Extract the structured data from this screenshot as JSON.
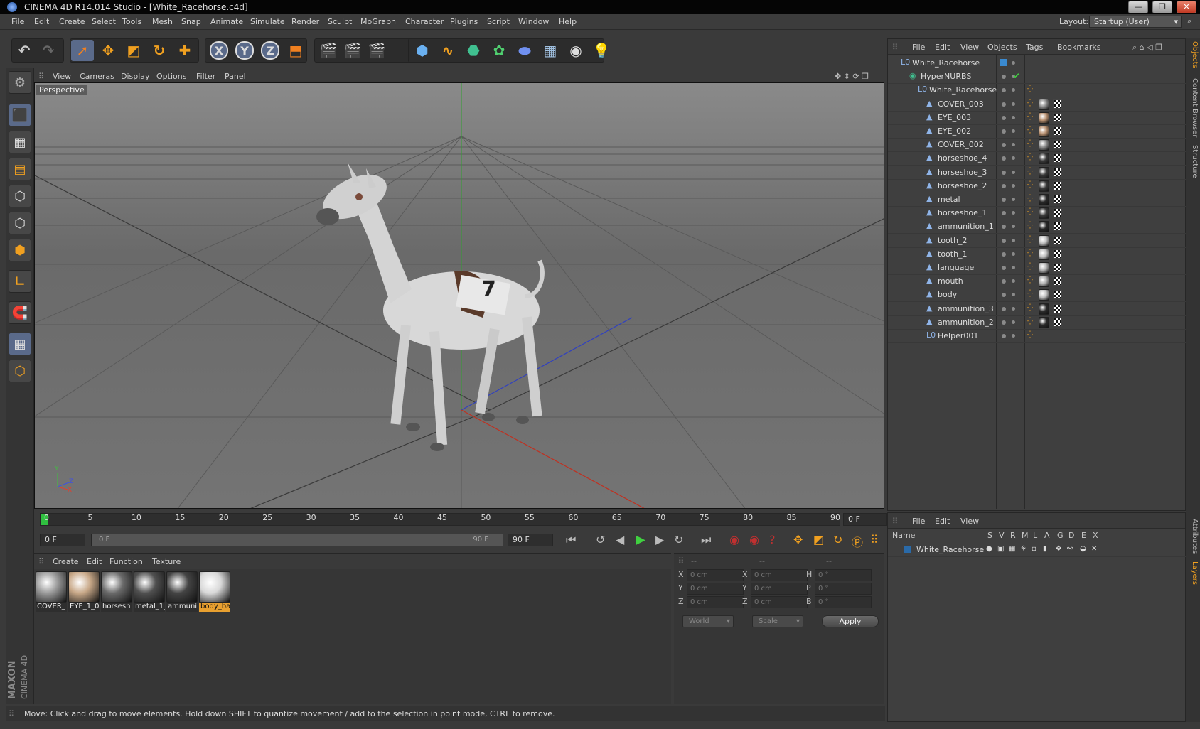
{
  "window": {
    "title": "CINEMA 4D R14.014 Studio - [White_Racehorse.c4d]",
    "buttons": [
      "—",
      "❐",
      "✕"
    ]
  },
  "menu": {
    "items": [
      "File",
      "Edit",
      "Create",
      "Select",
      "Tools",
      "Mesh",
      "Snap",
      "Animate",
      "Simulate",
      "Render",
      "Sculpt",
      "MoGraph",
      "Character",
      "Plugins",
      "Script",
      "Window",
      "Help"
    ],
    "layout_label": "Layout:",
    "layout_value": "Startup (User)"
  },
  "toolbar": {
    "undo_icon": "undo-icon",
    "redo_icon": "redo-icon",
    "axis_x": "X",
    "axis_y": "Y",
    "axis_z": "Z"
  },
  "viewport": {
    "menu": [
      "View",
      "Cameras",
      "Display",
      "Options",
      "Filter",
      "Panel"
    ],
    "label": "Perspective",
    "axis_y": "Y",
    "axis_z": "Z",
    "axis_x": "X"
  },
  "timeline": {
    "ticks": [
      "0",
      "5",
      "10",
      "15",
      "20",
      "25",
      "30",
      "35",
      "40",
      "45",
      "50",
      "55",
      "60",
      "65",
      "70",
      "75",
      "80",
      "85",
      "90"
    ],
    "frame_field": "0 F",
    "start_field": "0 F",
    "range_start": "0 F",
    "range_end": "90 F",
    "end_field": "90 F"
  },
  "materials": {
    "menu": [
      "Create",
      "Edit",
      "Function",
      "Texture"
    ],
    "items": [
      {
        "label": "COVER_",
        "selected": false,
        "color": "#9a9a9a"
      },
      {
        "label": "EYE_1_0(",
        "selected": false,
        "color": "#c8a888"
      },
      {
        "label": "horsesh",
        "selected": false,
        "color": "#6a6a6a"
      },
      {
        "label": "metal_1_",
        "selected": false,
        "color": "#505050"
      },
      {
        "label": "ammuni",
        "selected": false,
        "color": "#444444"
      },
      {
        "label": "body_ba",
        "selected": true,
        "color": "#d8d8d8"
      }
    ]
  },
  "coordinates": {
    "headers": [
      "--",
      "--",
      "--"
    ],
    "rows": [
      {
        "a": "X",
        "av": "0 cm",
        "b": "X",
        "bv": "0 cm",
        "c": "H",
        "cv": "0 °"
      },
      {
        "a": "Y",
        "av": "0 cm",
        "b": "Y",
        "bv": "0 cm",
        "c": "P",
        "cv": "0 °"
      },
      {
        "a": "Z",
        "av": "0 cm",
        "b": "Z",
        "bv": "0 cm",
        "c": "B",
        "cv": "0 °"
      }
    ],
    "world": "World",
    "scale": "Scale",
    "apply": "Apply"
  },
  "status": "Move: Click and drag to move elements. Hold down SHIFT to quantize movement / add to the selection in point mode, CTRL to remove.",
  "brand": {
    "maxon": "MAXON",
    "product": "CINEMA 4D"
  },
  "objects": {
    "menu": [
      "File",
      "Edit",
      "View",
      "Objects",
      "Tags",
      "Bookmarks"
    ],
    "rows": [
      {
        "name": "White_Racehorse",
        "indent": 0,
        "icon": "null-icon",
        "glyph": "L0"
      },
      {
        "name": "HyperNURBS",
        "indent": 1,
        "icon": "hypernurbs-icon",
        "glyph": "◉"
      },
      {
        "name": "White_Racehorse",
        "indent": 2,
        "icon": "null-icon",
        "glyph": "L0"
      },
      {
        "name": "COVER_003",
        "indent": 3,
        "icon": "polygon-icon",
        "glyph": "▲"
      },
      {
        "name": "EYE_003",
        "indent": 3,
        "icon": "polygon-icon",
        "glyph": "▲"
      },
      {
        "name": "EYE_002",
        "indent": 3,
        "icon": "polygon-icon",
        "glyph": "▲"
      },
      {
        "name": "COVER_002",
        "indent": 3,
        "icon": "polygon-icon",
        "glyph": "▲"
      },
      {
        "name": "horseshoe_4",
        "indent": 3,
        "icon": "polygon-icon",
        "glyph": "▲"
      },
      {
        "name": "horseshoe_3",
        "indent": 3,
        "icon": "polygon-icon",
        "glyph": "▲"
      },
      {
        "name": "horseshoe_2",
        "indent": 3,
        "icon": "polygon-icon",
        "glyph": "▲"
      },
      {
        "name": "metal",
        "indent": 3,
        "icon": "polygon-icon",
        "glyph": "▲"
      },
      {
        "name": "horseshoe_1",
        "indent": 3,
        "icon": "polygon-icon",
        "glyph": "▲"
      },
      {
        "name": "ammunition_1",
        "indent": 3,
        "icon": "polygon-icon",
        "glyph": "▲"
      },
      {
        "name": "tooth_2",
        "indent": 3,
        "icon": "polygon-icon",
        "glyph": "▲"
      },
      {
        "name": "tooth_1",
        "indent": 3,
        "icon": "polygon-icon",
        "glyph": "▲"
      },
      {
        "name": "language",
        "indent": 3,
        "icon": "polygon-icon",
        "glyph": "▲"
      },
      {
        "name": "mouth",
        "indent": 3,
        "icon": "polygon-icon",
        "glyph": "▲"
      },
      {
        "name": "body",
        "indent": 3,
        "icon": "polygon-icon",
        "glyph": "▲"
      },
      {
        "name": "ammunition_3",
        "indent": 3,
        "icon": "polygon-icon",
        "glyph": "▲"
      },
      {
        "name": "ammunition_2",
        "indent": 3,
        "icon": "polygon-icon",
        "glyph": "▲"
      },
      {
        "name": "Helper001",
        "indent": 3,
        "icon": "null-icon",
        "glyph": "L0"
      }
    ],
    "tag_colors": [
      "#8a8a8a",
      "#b89070",
      "#b89070",
      "#8a8a8a",
      "#3a3a3a",
      "#3a3a3a",
      "#3a3a3a",
      "#2a2a2a",
      "#3a3a3a",
      "#2a2a2a",
      "#c0c0c0",
      "#c0c0c0",
      "#b0b0b0",
      "#b0b0b0",
      "#c0c0c0",
      "#2a2a2a",
      "#2a2a2a"
    ]
  },
  "layers": {
    "menu": [
      "File",
      "Edit",
      "View"
    ],
    "columns": [
      "Name",
      "S",
      "V",
      "R",
      "M",
      "L",
      "A",
      "G",
      "D",
      "E",
      "X"
    ],
    "rows": [
      {
        "name": "White_Racehorse",
        "color": "#2a6aa8"
      }
    ]
  },
  "sidetabs": {
    "right_top": [
      "Objects",
      "Content Browser",
      "Structure"
    ],
    "right_bottom": [
      "Attributes",
      "Layers"
    ]
  },
  "colors": {
    "accent": "#f0a020",
    "selection": "#e8a030"
  }
}
